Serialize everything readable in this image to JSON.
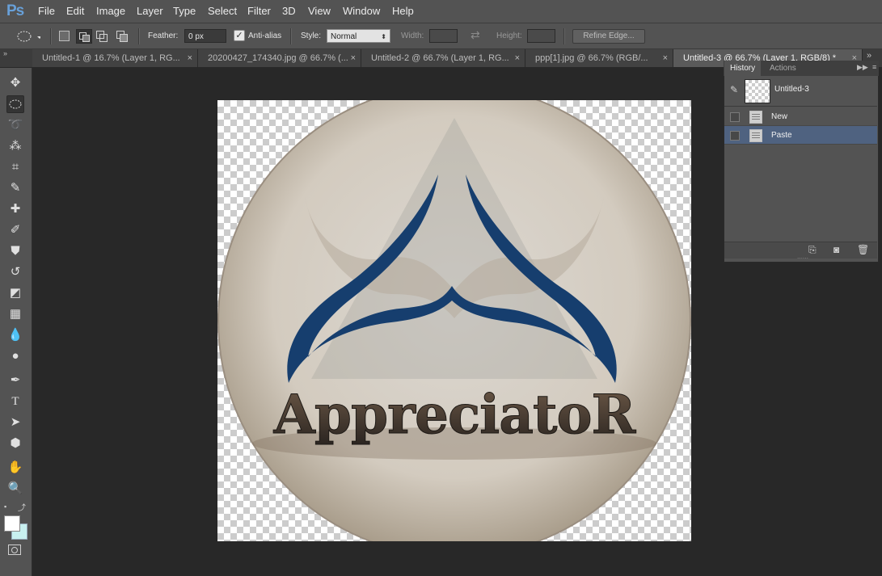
{
  "app": {
    "logo": "Ps"
  },
  "menu": [
    "File",
    "Edit",
    "Image",
    "Layer",
    "Type",
    "Select",
    "Filter",
    "3D",
    "View",
    "Window",
    "Help"
  ],
  "options": {
    "feather_label": "Feather:",
    "feather_value": "0 px",
    "antialias_label": "Anti-alias",
    "antialias_checked": true,
    "style_label": "Style:",
    "style_value": "Normal",
    "width_label": "Width:",
    "height_label": "Height:",
    "refine_label": "Refine Edge..."
  },
  "tabs": [
    {
      "label": "Untitled-1 @ 16.7% (Layer 1, RG...",
      "close": "×"
    },
    {
      "label": "20200427_174340.jpg @ 66.7% (...",
      "close": "×"
    },
    {
      "label": "Untitled-2 @ 66.7% (Layer 1, RG...",
      "close": "×"
    },
    {
      "label": "ppp[1].jpg @ 66.7% (RGB/...",
      "close": "×"
    },
    {
      "label": "Untitled-3 @ 66.7% (Layer 1, RGB/8) *",
      "close": "×"
    }
  ],
  "canvas": {
    "logo_text": "AppreciatoR",
    "logo_colors": {
      "wings": "#163e6e",
      "disc": "#d9d2c8",
      "triangle": "#a3a29d"
    }
  },
  "history": {
    "tab_history": "History",
    "tab_actions": "Actions",
    "snapshot_label": "Untitled-3",
    "steps": [
      {
        "label": "New",
        "selected": false
      },
      {
        "label": "Paste",
        "selected": true
      }
    ]
  },
  "colors": {
    "accent_selection": "#4f6280",
    "ps_blue": "#68a0d8"
  }
}
